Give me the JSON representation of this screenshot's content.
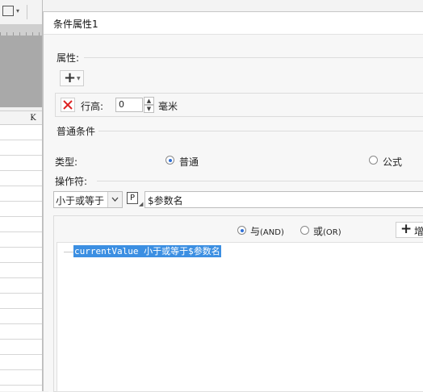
{
  "spreadsheet": {
    "column_header": "K"
  },
  "dialog": {
    "title": "条件属性1",
    "properties": {
      "section_label": "属性:",
      "row_height_label": "行高:",
      "row_height_value": "0",
      "unit_label": "毫米"
    },
    "normal_condition": {
      "section_label": "普通条件",
      "type_label": "类型:",
      "type_options": [
        "普通",
        "公式"
      ],
      "type_selected": "普通",
      "operator_label": "操作符:",
      "operator_value": "小于或等于",
      "param_button_label": "P",
      "value_text": "$参数名"
    },
    "combine": {
      "and_label": "与",
      "and_hint": "(AND)",
      "or_label": "或",
      "or_hint": "(OR)",
      "selected": "and",
      "add_button_label": "增"
    },
    "condition_list": [
      "currentValue 小于或等于$参数名"
    ]
  }
}
